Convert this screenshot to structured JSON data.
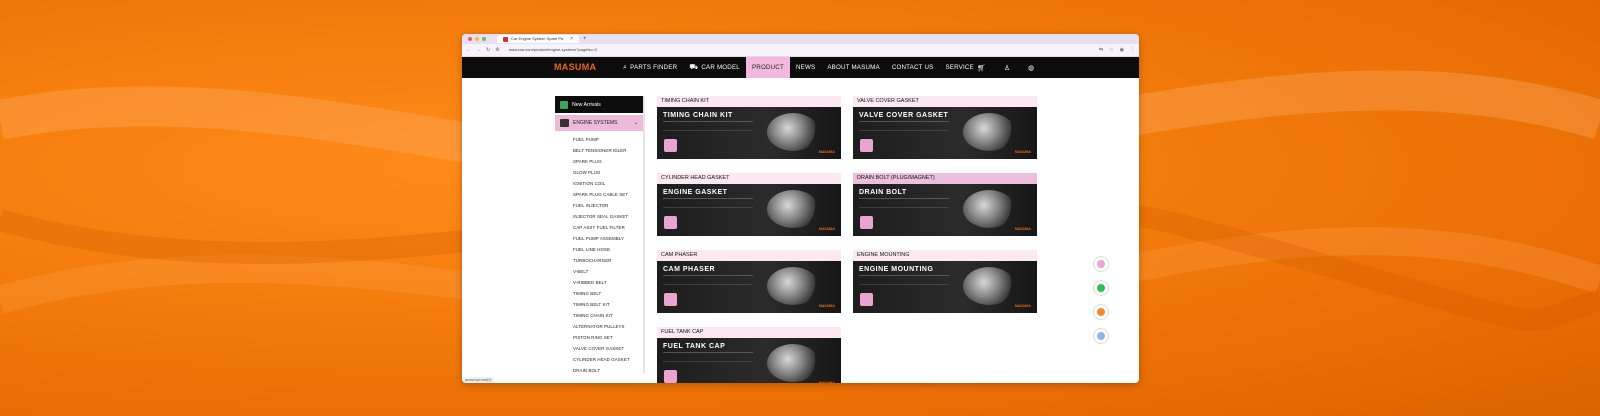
{
  "browser": {
    "tab_title": "Car Engine System Spare Pa",
    "tab_close": "×",
    "new_tab": "+",
    "url": "masuma.com/product/engine-systems?pageNo=2",
    "status_url": "javascript:void(0)"
  },
  "nav": {
    "logo": "MASUMA",
    "items": [
      {
        "label": "PARTS FINDER",
        "icon": "search-icon"
      },
      {
        "label": "CAR MODEL",
        "icon": "car-icon"
      },
      {
        "label": "PRODUCT"
      },
      {
        "label": "NEWS"
      },
      {
        "label": "ABOUT MASUMA"
      },
      {
        "label": "CONTACT US"
      },
      {
        "label": "SERVICE"
      }
    ],
    "active": "PRODUCT"
  },
  "sidebar": {
    "new_arrivals": "New Arrivals",
    "category": "ENGINE SYSTEMS",
    "items": [
      "FUEL PUMP",
      "BELT TENSIONER IDLER",
      "SPARK PLUG",
      "GLOW PLUG",
      "IGNITION COIL",
      "SPARK PLUG CABLE SET",
      "FUEL INJECTOR",
      "INJECTOR SEAL GASKET",
      "CAP ASSY FUEL FILTER",
      "FUEL PUMP ASSEMBLY",
      "FUEL LINE HOSE",
      "TURBOCHARGER",
      "V-BELT",
      "V-RIBBED BELT",
      "TIMING BELT",
      "TIMING BELT KIT",
      "TIMING CHAIN KIT",
      "ALTERNATOR PULLEYS",
      "PISTON RING SET",
      "VALVE COVER GASKET",
      "CYLINDER HEAD GASKET",
      "DRAIN BOLT"
    ]
  },
  "cards": [
    {
      "title": "TIMING CHAIN KIT",
      "banner": "TIMING CHAIN KIT",
      "brand": "MASUMA"
    },
    {
      "title": "VALVE COVER GASKET",
      "banner": "VALVE COVER GASKET",
      "brand": "MASUMA"
    },
    {
      "title": "CYLINDER HEAD GASKET",
      "banner": "ENGINE GASKET",
      "brand": "MASUMA"
    },
    {
      "title": "DRAIN BOLT (PLUG/MAGNET)",
      "banner": "DRAIN BOLT",
      "brand": "MASUMA"
    },
    {
      "title": "CAM PHASER",
      "banner": "CAM PHASER",
      "brand": "MASUMA"
    },
    {
      "title": "ENGINE MOUNTING",
      "banner": "ENGINE MOUNTING",
      "brand": "MASUMA"
    },
    {
      "title": "FUEL TANK CAP",
      "banner": "FUEL TANK CAP",
      "brand": "MASUMA"
    }
  ],
  "colors": {
    "accent_orange": "#e86a10",
    "active_pink": "#f2b9dc",
    "nav_black": "#0c0c0c",
    "background_orange": "#f47d0c"
  },
  "floating_buttons": [
    "email-icon",
    "whatsapp-icon",
    "chat-icon",
    "support-icon"
  ]
}
